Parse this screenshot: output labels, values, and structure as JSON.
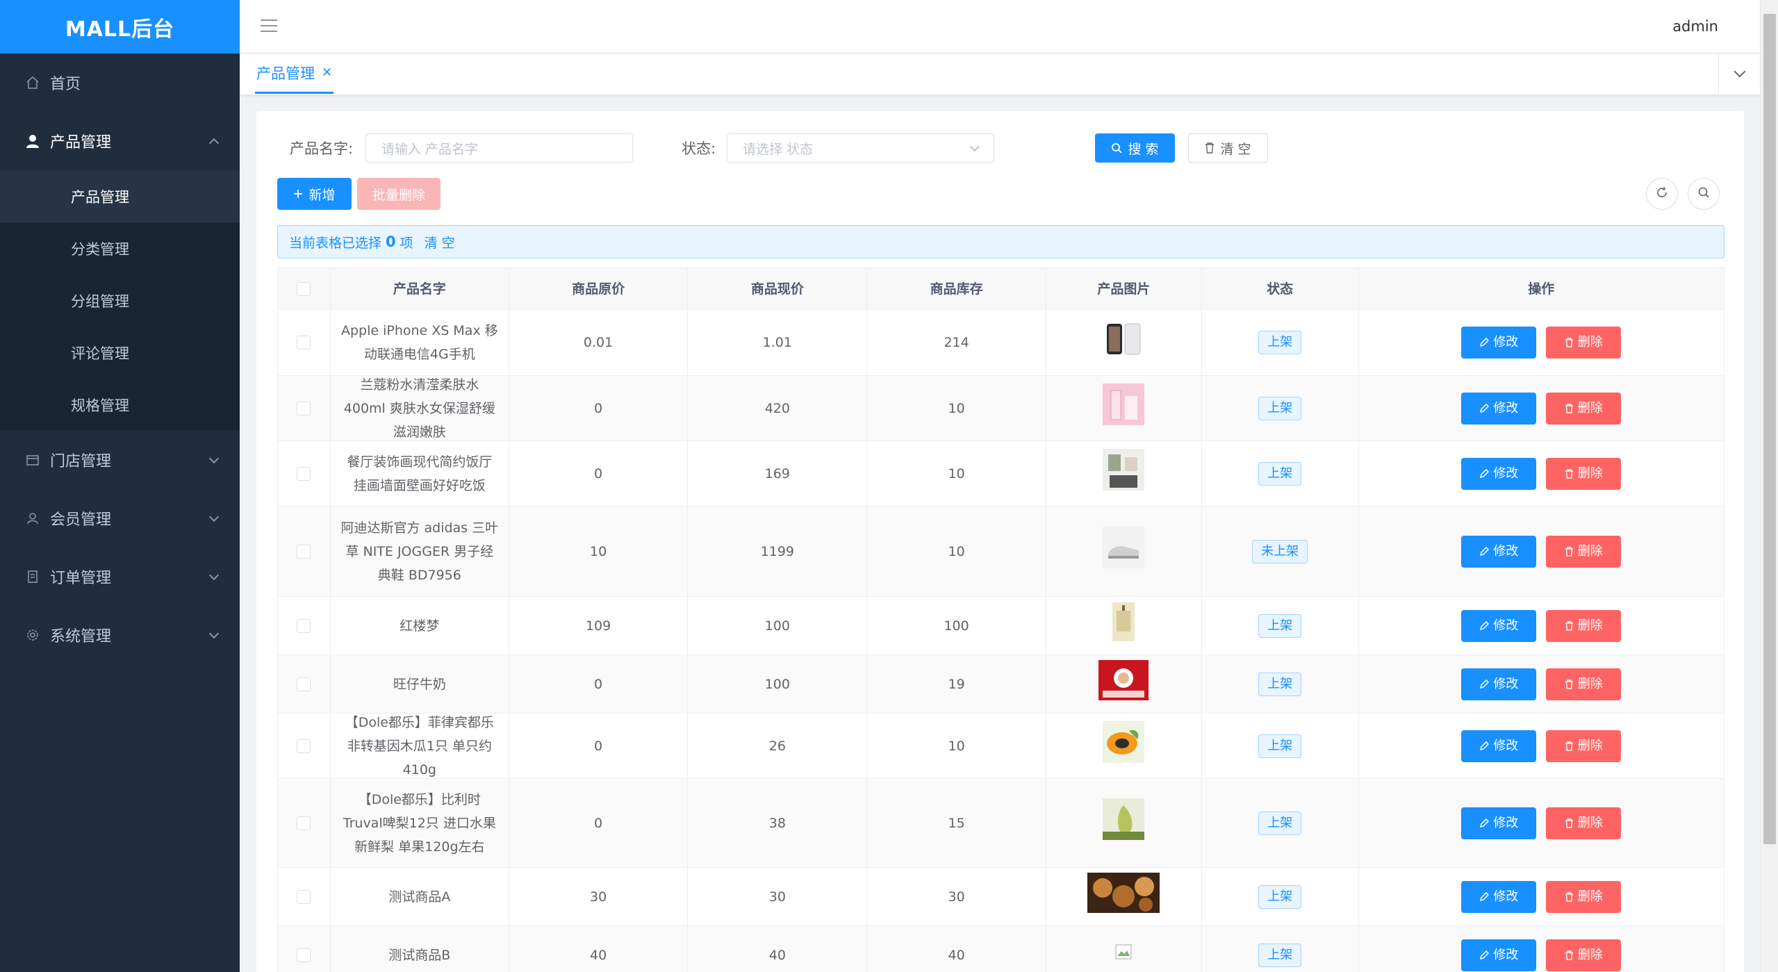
{
  "app": {
    "title": "MALL后台"
  },
  "sidebar": {
    "items": [
      {
        "label": "首页",
        "icon": "home-icon"
      },
      {
        "label": "产品管理",
        "icon": "user-icon",
        "open": true,
        "children": [
          "产品管理",
          "分类管理",
          "分组管理",
          "评论管理",
          "规格管理"
        ],
        "active_child": 0
      },
      {
        "label": "门店管理",
        "icon": "store-icon"
      },
      {
        "label": "会员管理",
        "icon": "member-icon"
      },
      {
        "label": "订单管理",
        "icon": "order-icon"
      },
      {
        "label": "系统管理",
        "icon": "gear-icon"
      }
    ]
  },
  "header": {
    "user": "admin"
  },
  "tabs": [
    {
      "label": "产品管理",
      "active": true
    }
  ],
  "search": {
    "name_label": "产品名字:",
    "name_placeholder": "请输入 产品名字",
    "status_label": "状态:",
    "status_placeholder": "请选择 状态",
    "search_button": "搜 索",
    "clear_button": "清 空"
  },
  "toolbar": {
    "add_button": "新增",
    "batch_delete_button": "批量删除"
  },
  "selection": {
    "prefix": "当前表格已选择",
    "count": "0",
    "suffix": "项",
    "clear": "清 空"
  },
  "table": {
    "columns": [
      "产品名字",
      "商品原价",
      "商品现价",
      "商品库存",
      "产品图片",
      "状态",
      "操作"
    ],
    "edit_label": "修改",
    "delete_label": "删除",
    "rows": [
      {
        "name": "Apple iPhone XS Max 移动联通电信4G手机",
        "original_price": "0.01",
        "price": "1.01",
        "stock": "214",
        "status": "上架",
        "image": "phone"
      },
      {
        "name": "兰蔻粉水清滢柔肤水400ml 爽肤水女保湿舒缓滋润嫩肤",
        "original_price": "0",
        "price": "420",
        "stock": "10",
        "status": "上架",
        "image": "cosmetics"
      },
      {
        "name": "餐厅装饰画现代简约饭厅挂画墙面壁画好好吃饭",
        "original_price": "0",
        "price": "169",
        "stock": "10",
        "status": "上架",
        "image": "painting"
      },
      {
        "name": "阿迪达斯官方 adidas 三叶草 NITE JOGGER 男子经典鞋 BD7956",
        "original_price": "10",
        "price": "1199",
        "stock": "10",
        "status": "未上架",
        "image": "shoe"
      },
      {
        "name": "红楼梦",
        "original_price": "109",
        "price": "100",
        "stock": "100",
        "status": "上架",
        "image": "book"
      },
      {
        "name": "旺仔牛奶",
        "original_price": "0",
        "price": "100",
        "stock": "19",
        "status": "上架",
        "image": "milk"
      },
      {
        "name": "【Dole都乐】菲律宾都乐非转基因木瓜1只 单只约410g",
        "original_price": "0",
        "price": "26",
        "stock": "10",
        "status": "上架",
        "image": "papaya"
      },
      {
        "name": "【Dole都乐】比利时Truval啤梨12只 进口水果新鲜梨 单果120g左右",
        "original_price": "0",
        "price": "38",
        "stock": "15",
        "status": "上架",
        "image": "pear"
      },
      {
        "name": "测试商品A",
        "original_price": "30",
        "price": "30",
        "stock": "30",
        "status": "上架",
        "image": "bread"
      },
      {
        "name": "测试商品B",
        "original_price": "40",
        "price": "40",
        "stock": "40",
        "status": "上架",
        "image": "broken"
      }
    ]
  },
  "colors": {
    "primary": "#1890ff",
    "sidebar": "#1f2d3d",
    "danger": "#ff4949"
  }
}
